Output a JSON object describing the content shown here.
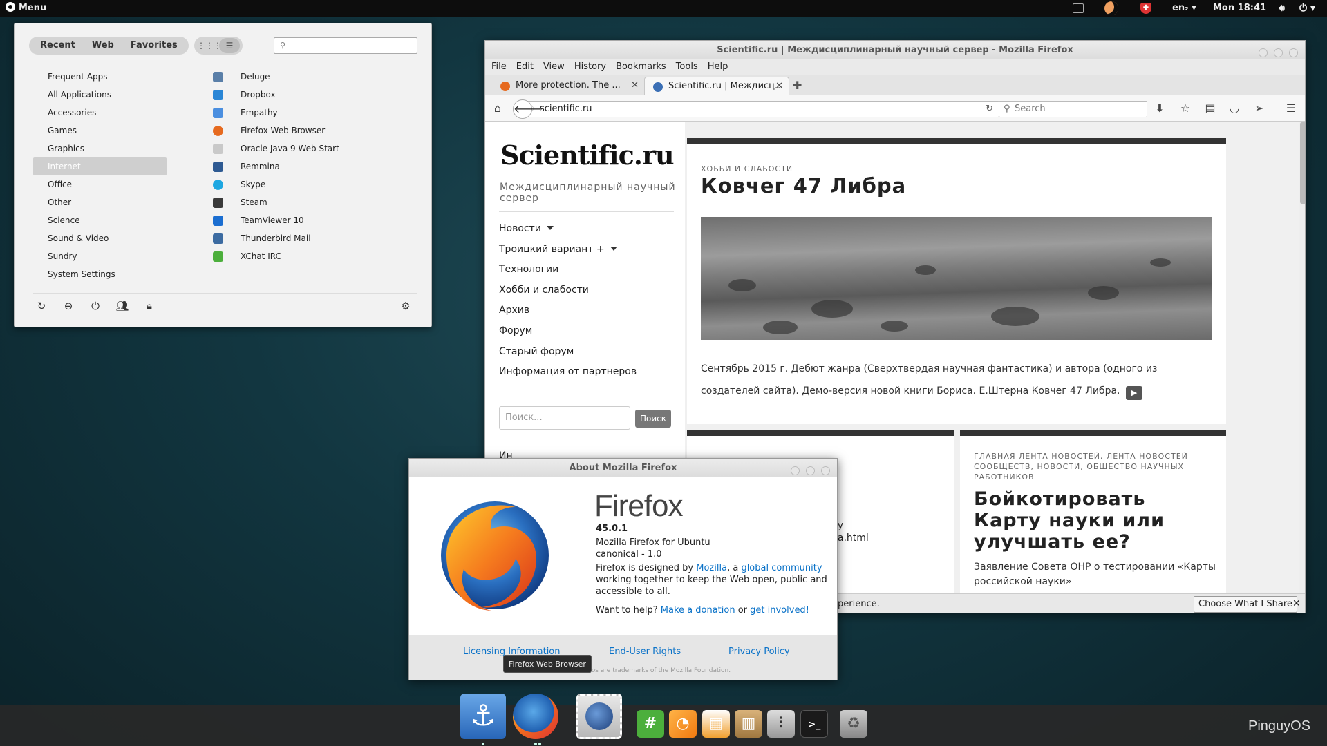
{
  "top_panel": {
    "menu_label": "Menu",
    "keyboard_layout": "en₂ ▾",
    "clock": "Mon 18:41"
  },
  "app_menu": {
    "tabs": [
      "Recent",
      "Web",
      "Favorites"
    ],
    "categories": [
      "Frequent Apps",
      "All Applications",
      "Accessories",
      "Games",
      "Graphics",
      "Internet",
      "Office",
      "Other",
      "Science",
      "Sound & Video",
      "Sundry",
      "System Settings"
    ],
    "active_category": "Internet",
    "apps": [
      {
        "label": "Deluge",
        "icon": "deluge-icon",
        "color": "#5a7fa8"
      },
      {
        "label": "Dropbox",
        "icon": "dropbox-icon",
        "color": "#2a86d6"
      },
      {
        "label": "Empathy",
        "icon": "empathy-icon",
        "color": "#4b8fe0"
      },
      {
        "label": "Firefox Web Browser",
        "icon": "firefox-icon",
        "color": "#e66a1f"
      },
      {
        "label": "Oracle Java 9 Web Start",
        "icon": "java-icon",
        "color": "#c9c9c9"
      },
      {
        "label": "Remmina",
        "icon": "remmina-icon",
        "color": "#2e5a92"
      },
      {
        "label": "Skype",
        "icon": "skype-icon",
        "color": "#1ea7e1"
      },
      {
        "label": "Steam",
        "icon": "steam-icon",
        "color": "#3a3a3a"
      },
      {
        "label": "TeamViewer 10",
        "icon": "teamviewer-icon",
        "color": "#1b6ed1"
      },
      {
        "label": "Thunderbird Mail",
        "icon": "thunderbird-icon",
        "color": "#3c6ba1"
      },
      {
        "label": "XChat IRC",
        "icon": "xchat-icon",
        "color": "#4caf3c"
      }
    ]
  },
  "firefox": {
    "window_title": "Scientific.ru | Междисциплинарный научный сервер - Mozilla Firefox",
    "menubar": [
      "File",
      "Edit",
      "View",
      "History",
      "Bookmarks",
      "Tools",
      "Help"
    ],
    "tabs": [
      {
        "label": "More protection. The ..."
      },
      {
        "label": "Scientific.ru | Междисц..."
      }
    ],
    "url": "scientific.ru",
    "search_placeholder": "Search"
  },
  "site": {
    "logo": "Scientific.ru",
    "tagline": "Междисциплинарный научный сервер",
    "nav": [
      "Новости",
      "Троицкий вариант +",
      "Технологии",
      "Хобби и слабости",
      "Архив",
      "Форум",
      "Старый форум",
      "Информация от партнеров"
    ],
    "search_placeholder": "Поиск...",
    "search_button": "Поиск",
    "cut_text": "Ин",
    "main_article": {
      "kicker": "ХОББИ И СЛАБОСТИ",
      "title": "Ковчег 47 Либра",
      "text": "Сентябрь 2015 г. Дебют жанра (Сверхтвердая научная фантастика) и автора (одного из создателей сайта). Демо-версия новой книги Бориса. Е.Штерна Ковчег 47 Либра.",
      "more": "▶"
    },
    "card_left": {
      "frag1": "су",
      "frag2": "ka.html"
    },
    "card_right": {
      "kicker": "ГЛАВНАЯ ЛЕНТА НОВОСТЕЙ, ЛЕНТА НОВОСТЕЙ СООБЩЕСТВ, НОВОСТИ, ОБЩЕСТВО НАУЧНЫХ РАБОТНИКОВ",
      "title": "Бойкотировать Карту науки или улучшать ее?",
      "text": "Заявление Совета ОНР о тестировании «Карты российской науки»"
    },
    "notification": {
      "text": "perience.",
      "button": "Choose What I Share",
      "close": "✕"
    }
  },
  "about_dialog": {
    "title": "About Mozilla Firefox",
    "brand": "Firefox",
    "version": "45.0.1",
    "line1": "Mozilla Firefox for Ubuntu",
    "line2": "canonical - 1.0",
    "designed_prefix": "Firefox is designed by ",
    "mozilla_link": "Mozilla",
    "comma": ", a ",
    "community_link": "global community",
    "line4": "working together to keep the Web open, public and",
    "line5": "accessible to all.",
    "help_prefix": "Want to help? ",
    "donation_link": "Make a donation",
    "or": " or ",
    "involved_link": "get involved!",
    "footer_links": [
      "Licensing Information",
      "End-User Rights",
      "Privacy Policy"
    ],
    "fine_print": "logos are trademarks of the Mozilla Foundation."
  },
  "tooltip": "Firefox Web Browser",
  "dock": {
    "items": [
      "anchor-icon",
      "firefox-icon",
      "thunderbird-icon",
      "xchat-icon",
      "sublime-icon",
      "video-editor-icon",
      "archive-icon",
      "mixer-icon",
      "terminal-icon",
      "trash-icon"
    ],
    "hash": "#",
    "prompt": ">_"
  },
  "watermark": "PinguyOS"
}
